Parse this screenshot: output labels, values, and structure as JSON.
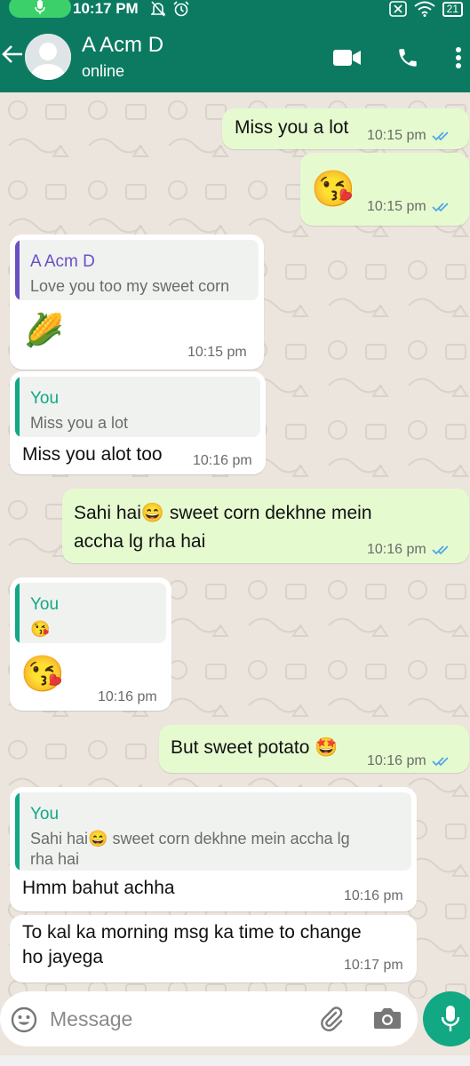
{
  "status_bar": {
    "time": "10:17 PM",
    "battery": "21"
  },
  "header": {
    "contact_name": "A Acm D",
    "contact_status": "online"
  },
  "messages": [
    {
      "text": "Miss you a lot",
      "time": "10:15 pm"
    },
    {
      "emoji": "😘",
      "time": "10:15 pm"
    },
    {
      "quote_author": "A Acm D",
      "quote_text": "Love you too my sweet corn",
      "emoji": "🌽",
      "time": "10:15 pm"
    },
    {
      "quote_author": "You",
      "quote_text": "Miss you a lot",
      "text": "Miss you alot too",
      "time": "10:16 pm"
    },
    {
      "line1": "Sahi hai😄 sweet corn dekhne mein",
      "line2": "accha lg rha  hai",
      "time": "10:16 pm"
    },
    {
      "quote_author": "You",
      "quote_text": "😘",
      "emoji": "😘",
      "time": "10:16 pm"
    },
    {
      "text": "But sweet potato 🤩",
      "time": "10:16 pm"
    },
    {
      "quote_author": "You",
      "quote_line1": "Sahi hai😄 sweet corn dekhne mein accha lg",
      "quote_line2": "rha  hai",
      "text": "Hmm bahut achha",
      "time": "10:16 pm"
    },
    {
      "line1": "To kal ka morning msg ka time to change",
      "line2": "ho jayega",
      "time": "10:17 pm"
    }
  ],
  "composer": {
    "placeholder": "Message"
  },
  "colors": {
    "header": "#0b7a61",
    "outgoing_bubble": "#e5fbcf",
    "incoming_bubble": "#ffffff",
    "quote_bar_contact": "#6a4fc4",
    "quote_bar_you": "#12a884",
    "read_ticks": "#53a6e6",
    "mic_fab": "#12a884"
  },
  "icons": [
    "mic-icon",
    "mute-icon",
    "alarm-icon",
    "close-box-icon",
    "wifi-icon",
    "battery-icon",
    "back-arrow-icon",
    "avatar-icon",
    "video-call-icon",
    "phone-icon",
    "more-options-icon",
    "read-ticks-icon",
    "emoji-icon",
    "attach-icon",
    "camera-icon",
    "mic-fab-icon"
  ]
}
